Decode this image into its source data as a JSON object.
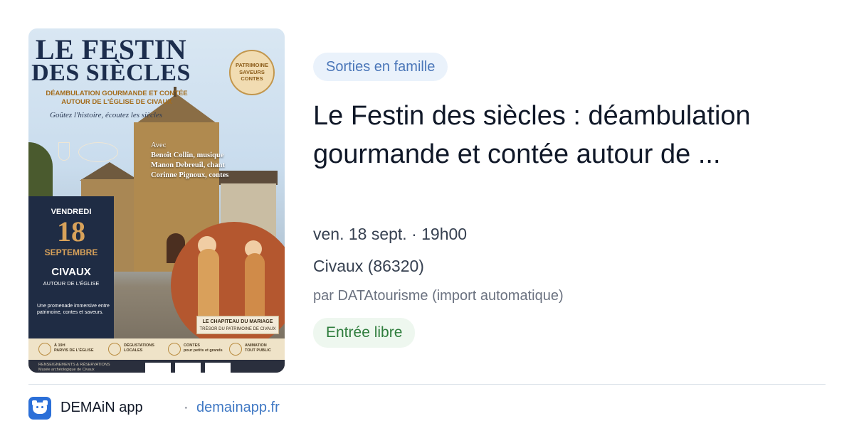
{
  "poster": {
    "title_line1": "LE FESTIN",
    "title_line2": "DES SIÈCLES",
    "subtitle_line1": "DÉAMBULATION GOURMANDE ET CONTÉE",
    "subtitle_line2": "AUTOUR DE L'ÉGLISE DE CIVAUX",
    "slogan": "Goûtez l'histoire, écoutez les siècles",
    "seal": [
      "PATRIMOINE",
      "SAVEURS",
      "CONTES"
    ],
    "avec_label": "Avec",
    "performers": [
      "Benoît Collin, musique",
      "Manon Debreuil, chant",
      "Corinne Pignoux, contes"
    ],
    "day": "VENDREDI",
    "day_number": "18",
    "month": "SEPTEMBRE",
    "city": "CIVAUX",
    "city_location": "AUTOUR DE L'ÉGLISE",
    "promo": "Une promenade immersive entre patrimoine, contes et saveurs.",
    "banner_title": "LE CHAPITEAU DU MARIAGE",
    "banner_subtitle": "TRÉSOR DU PATRIMOINE DE CIVAUX",
    "info": [
      {
        "text1": "À 19H",
        "text2": "PARVIS DE L'ÉGLISE"
      },
      {
        "text1": "DÉGUSTATIONS",
        "text2": "LOCALES"
      },
      {
        "text1": "CONTES",
        "text2": "pour petits et grands"
      },
      {
        "text1": "ANIMATION",
        "text2": "TOUT PUBLIC"
      }
    ],
    "footer_text1": "RENSEIGNEMENTS & RÉSERVATIONS",
    "footer_text2": "Musée archéologique de Civaux"
  },
  "category": "Sorties en famille",
  "title": "Le Festin des siècles : déambulation gourmande et contée autour de ...",
  "date": "ven. 18 sept. · 19h00",
  "place": "Civaux (86320)",
  "author": "par DATAtourisme (import automatique)",
  "price_tag": "Entrée libre",
  "footer": {
    "app_name": "DEMAiN app",
    "separator": "·",
    "link": "demainapp.fr"
  },
  "colors": {
    "category_chip_bg": "#eaf2fb",
    "category_chip_text": "#4a76b8",
    "free_chip_bg": "#eef7ef",
    "free_chip_text": "#2f7d3d",
    "link": "#3f78c4",
    "app_icon": "#2b6fd8"
  },
  "icons": [
    "demain-app-icon"
  ]
}
